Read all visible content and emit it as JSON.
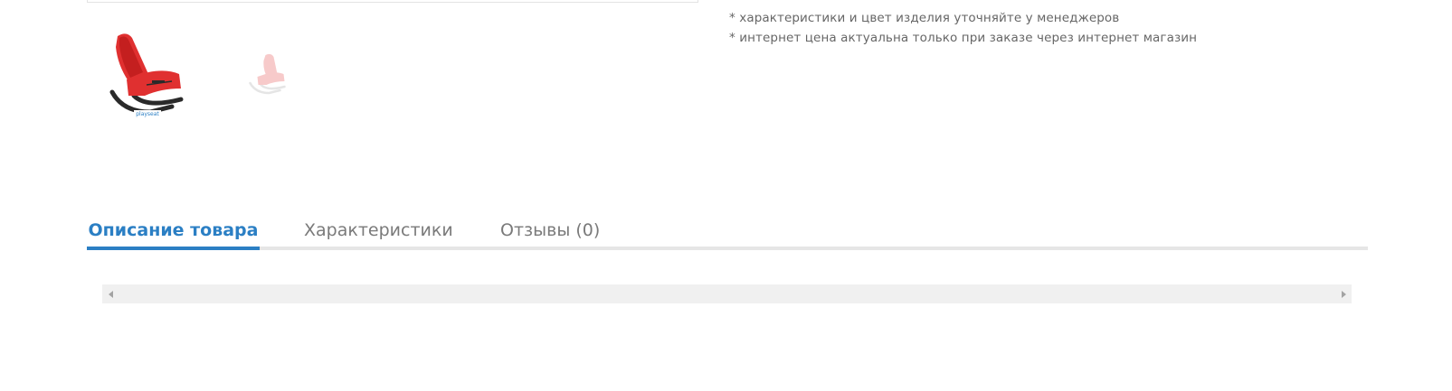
{
  "gallery": {
    "thumbnails": [
      {
        "icon": "chair-icon",
        "state": "active",
        "color": "#e03030",
        "brand_text": "playseat"
      },
      {
        "icon": "chair-icon",
        "state": "inactive",
        "color": "#e03030"
      }
    ]
  },
  "notes": [
    "* характеристики и цвет изделия уточняйте у менеджеров",
    "* интернет цена актуальна только при заказе через интернет магазин"
  ],
  "tabs": [
    {
      "label": "Описание товара",
      "active": true
    },
    {
      "label": "Характеристики",
      "active": false
    },
    {
      "label": "Отзывы (0)",
      "active": false
    }
  ],
  "colors": {
    "accent": "#2b7fc4",
    "tab_inactive": "#7a7a7a",
    "text": "#666666",
    "tab_line": "#e6e6e6",
    "scrollbar_track": "#f0f0f0"
  },
  "scrollbar": {
    "left_icon": "arrow-left-icon",
    "right_icon": "arrow-right-icon"
  }
}
